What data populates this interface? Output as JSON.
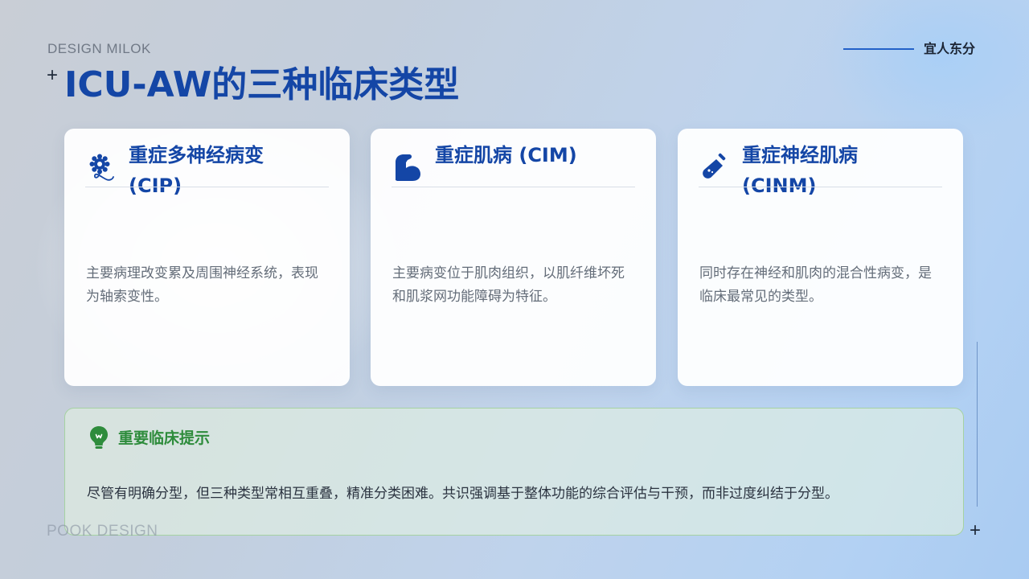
{
  "header": {
    "brand_top": "DESIGN MILOK",
    "plus": "+",
    "title": "ICU-AW的三种临床类型",
    "top_right": "宜人东分"
  },
  "cards": [
    {
      "icon": "gear-nerve-icon",
      "title": "重症多神经病变 (CIP)",
      "description": "主要病理改变累及周围神经系统，表现为轴索变性。"
    },
    {
      "icon": "flexed-arm-muscle-icon",
      "title": "重症肌病 (CIM)",
      "description": "主要病变位于肌肉组织，以肌纤维坏死和肌浆网功能障碍为特征。"
    },
    {
      "icon": "test-tube-icon",
      "title": "重症神经肌病 (CINM)",
      "description": "同时存在神经和肌肉的混合性病变，是临床最常见的类型。"
    }
  ],
  "tip": {
    "icon": "lightbulb-icon",
    "title": "重要临床提示",
    "text": "尽管有明确分型，但三种类型常相互重叠，精准分类困难。共识强调基于整体功能的综合评估与干预，而非过度纠结于分型。"
  },
  "footer": {
    "brand_bottom": "POOK DESIGN",
    "plus": "+"
  },
  "colors": {
    "accent_blue": "#1446a6",
    "tip_green": "#2e8c3c",
    "tip_border": "#a6d2a2"
  }
}
